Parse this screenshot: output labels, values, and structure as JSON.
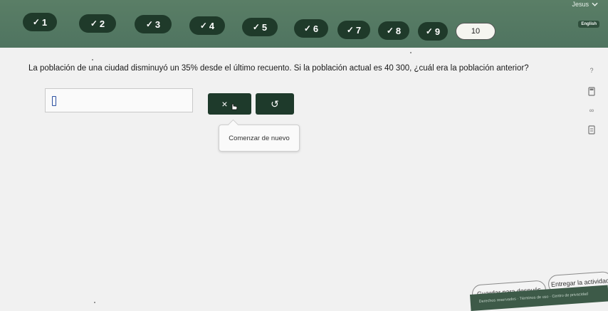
{
  "header": {
    "user_name": "Jesus",
    "language_label": "English",
    "steps": [
      {
        "label": "1",
        "done": true
      },
      {
        "label": "2",
        "done": true
      },
      {
        "label": "3",
        "done": true
      },
      {
        "label": "4",
        "done": true
      },
      {
        "label": "5",
        "done": true
      },
      {
        "label": "6",
        "done": true
      },
      {
        "label": "7",
        "done": true
      },
      {
        "label": "8",
        "done": true
      },
      {
        "label": "9",
        "done": true
      },
      {
        "label": "10",
        "done": false,
        "current": true
      }
    ]
  },
  "question": {
    "text": "La población de una ciudad disminuyó un 35% desde el último recuento. Si la población actual es 40 300, ¿cuál era la población anterior?"
  },
  "answer": {
    "value": ""
  },
  "keypad": {
    "clear_label": "×",
    "undo_label": "↺"
  },
  "popup": {
    "label": "Comenzar de nuevo"
  },
  "side_tools": {
    "help_label": "?",
    "infinity_label": "∞"
  },
  "actions": {
    "save_label": "Guardar para después",
    "submit_label": "Entregar la actividad"
  },
  "footer": {
    "text": "Derechos reservados · Términos de uso · Centro de privacidad"
  },
  "colors": {
    "header_bg": "#55796 2",
    "step_bg": "#1f3a2a",
    "button_bg": "#1e3a2b"
  }
}
